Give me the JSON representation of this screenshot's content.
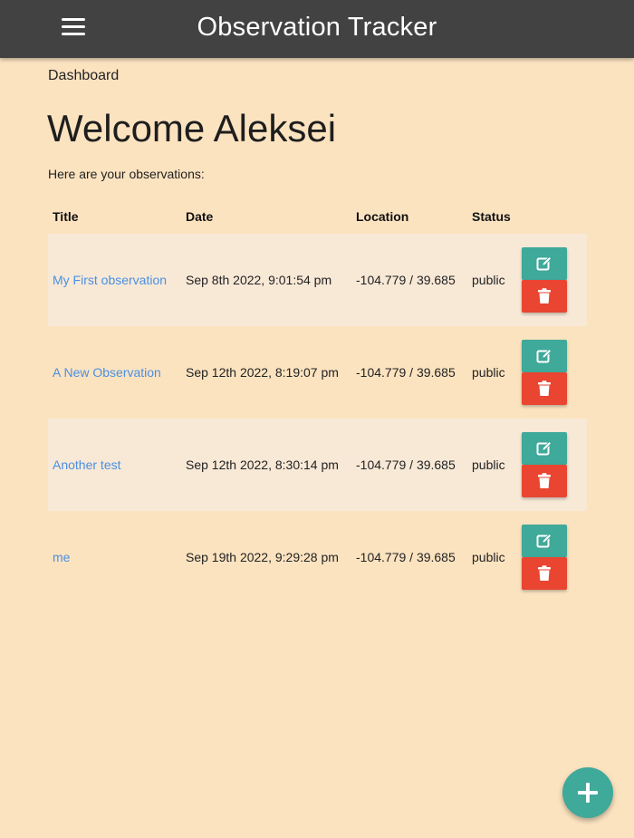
{
  "header": {
    "title": "Observation Tracker",
    "menu_icon": "hamburger-menu-icon"
  },
  "breadcrumb": "Dashboard",
  "welcome": "Welcome Aleksei",
  "subtitle": "Here are your observations:",
  "table": {
    "columns": [
      "Title",
      "Date",
      "Location",
      "Status"
    ],
    "rows": [
      {
        "title": "My First observation",
        "date": "Sep 8th 2022, 9:01:54 pm",
        "location": "-104.779 / 39.685",
        "status": "public"
      },
      {
        "title": "A New Observation",
        "date": "Sep 12th 2022, 8:19:07 pm",
        "location": "-104.779 / 39.685",
        "status": "public"
      },
      {
        "title": "Another test",
        "date": "Sep 12th 2022, 8:30:14 pm",
        "location": "-104.779 / 39.685",
        "status": "public"
      },
      {
        "title": "me",
        "date": "Sep 19th 2022, 9:29:28 pm",
        "location": "-104.779 / 39.685",
        "status": "public"
      }
    ]
  },
  "icons": {
    "edit": "edit-icon",
    "delete": "trash-icon",
    "add": "plus-icon"
  },
  "colors": {
    "background": "#fce3c0",
    "navbar": "#424242",
    "edit_button": "#3fa99a",
    "delete_button": "#e94531",
    "link": "#4a90e2",
    "fab": "#3fa99a"
  }
}
